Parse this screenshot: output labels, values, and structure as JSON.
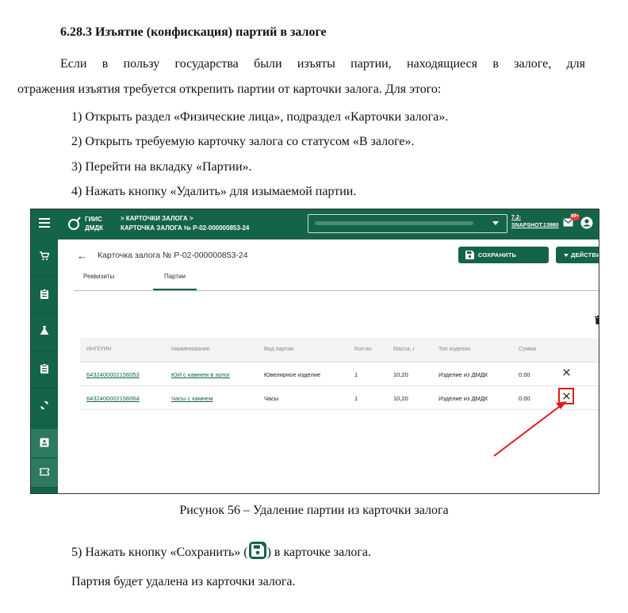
{
  "doc": {
    "heading": "6.28.3 Изъятие (конфискация) партий в залоге",
    "para1_line1": "Если в пользу государства были изъяты партии, находящиеся в залоге, для",
    "para1_line2": "отражения изъятия требуется открепить партии от карточки залога. Для этого:",
    "steps": [
      "1) Открыть раздел «Физические лица», подраздел «Карточки залога».",
      "2) Открыть требуемую карточку залога со статусом «В залоге».",
      "3) Перейти на вкладку «Партии».",
      "4) Нажать кнопку «Удалить» для изымаемой партии."
    ],
    "caption": "Рисунок 56 – Удаление партии из карточки залога",
    "step5_before": "5) Нажать кнопку «Сохранить» (",
    "step5_after": ") в карточке залога.",
    "final": "Партия будет удалена из карточки залога."
  },
  "app": {
    "logo_line1": "ГИИС",
    "logo_line2": "ДМДК",
    "crumb_line1": "> КАРТОЧКИ ЗАЛОГА >",
    "crumb_line2": "КАРТОЧКА ЗАЛОГА № Р-02-000000853-24",
    "version_line1": "7.2-",
    "version_line2": "SNAPSHOT.13980",
    "badge": "99+",
    "card_title": "Карточка залога № Р-02-000000853-24",
    "save_label": "СОХРАНИТЬ",
    "action_label": "ДЕЙСТВИЕ",
    "tabs": [
      "Реквизиты",
      "Партии"
    ],
    "columns": [
      "ИНП/УИН",
      "Наименование",
      "Вид партии",
      "Кол-во",
      "Масса, г",
      "Тип изделия",
      "Сумма"
    ],
    "rows": [
      [
        "6432400002156053",
        "ЮИ с камнем в золог",
        "Ювелирное изделие",
        "1",
        "10,20",
        "Изделие из ДМДК",
        "0.00"
      ],
      [
        "6432400002156064",
        "Часы с камнем",
        "Часы",
        "1",
        "10,20",
        "Изделие из ДМДК",
        "0.00"
      ]
    ],
    "colors": {
      "brand": "#146448",
      "highlight": "#e01b1b"
    }
  }
}
